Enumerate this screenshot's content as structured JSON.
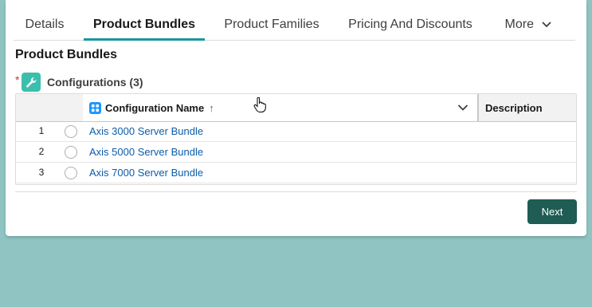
{
  "tabs": [
    {
      "label": "Details",
      "active": false
    },
    {
      "label": "Product Bundles",
      "active": true
    },
    {
      "label": "Product Families",
      "active": false
    },
    {
      "label": "Pricing And Discounts",
      "active": false
    }
  ],
  "more_tab": {
    "label": "More",
    "icon": "chevron-down-icon"
  },
  "section": {
    "title": "Product Bundles"
  },
  "configurations": {
    "required_marker": "*",
    "icon": "wrench-icon",
    "icon_color": "#3bbfad",
    "label": "Configurations (3)",
    "columns": {
      "name": "Configuration Name",
      "name_sort": "↑",
      "description": "Description"
    },
    "rows": [
      {
        "number": "1",
        "name": "Axis 3000 Server Bundle"
      },
      {
        "number": "2",
        "name": "Axis 5000 Server Bundle"
      },
      {
        "number": "3",
        "name": "Axis 7000 Server Bundle"
      }
    ]
  },
  "footer": {
    "next_label": "Next"
  },
  "colors": {
    "background": "#8fc4c3",
    "tab_active_underline": "#1b96a0",
    "link": "#0b5cab",
    "next_button": "#1e5c54",
    "required": "#c23934"
  }
}
